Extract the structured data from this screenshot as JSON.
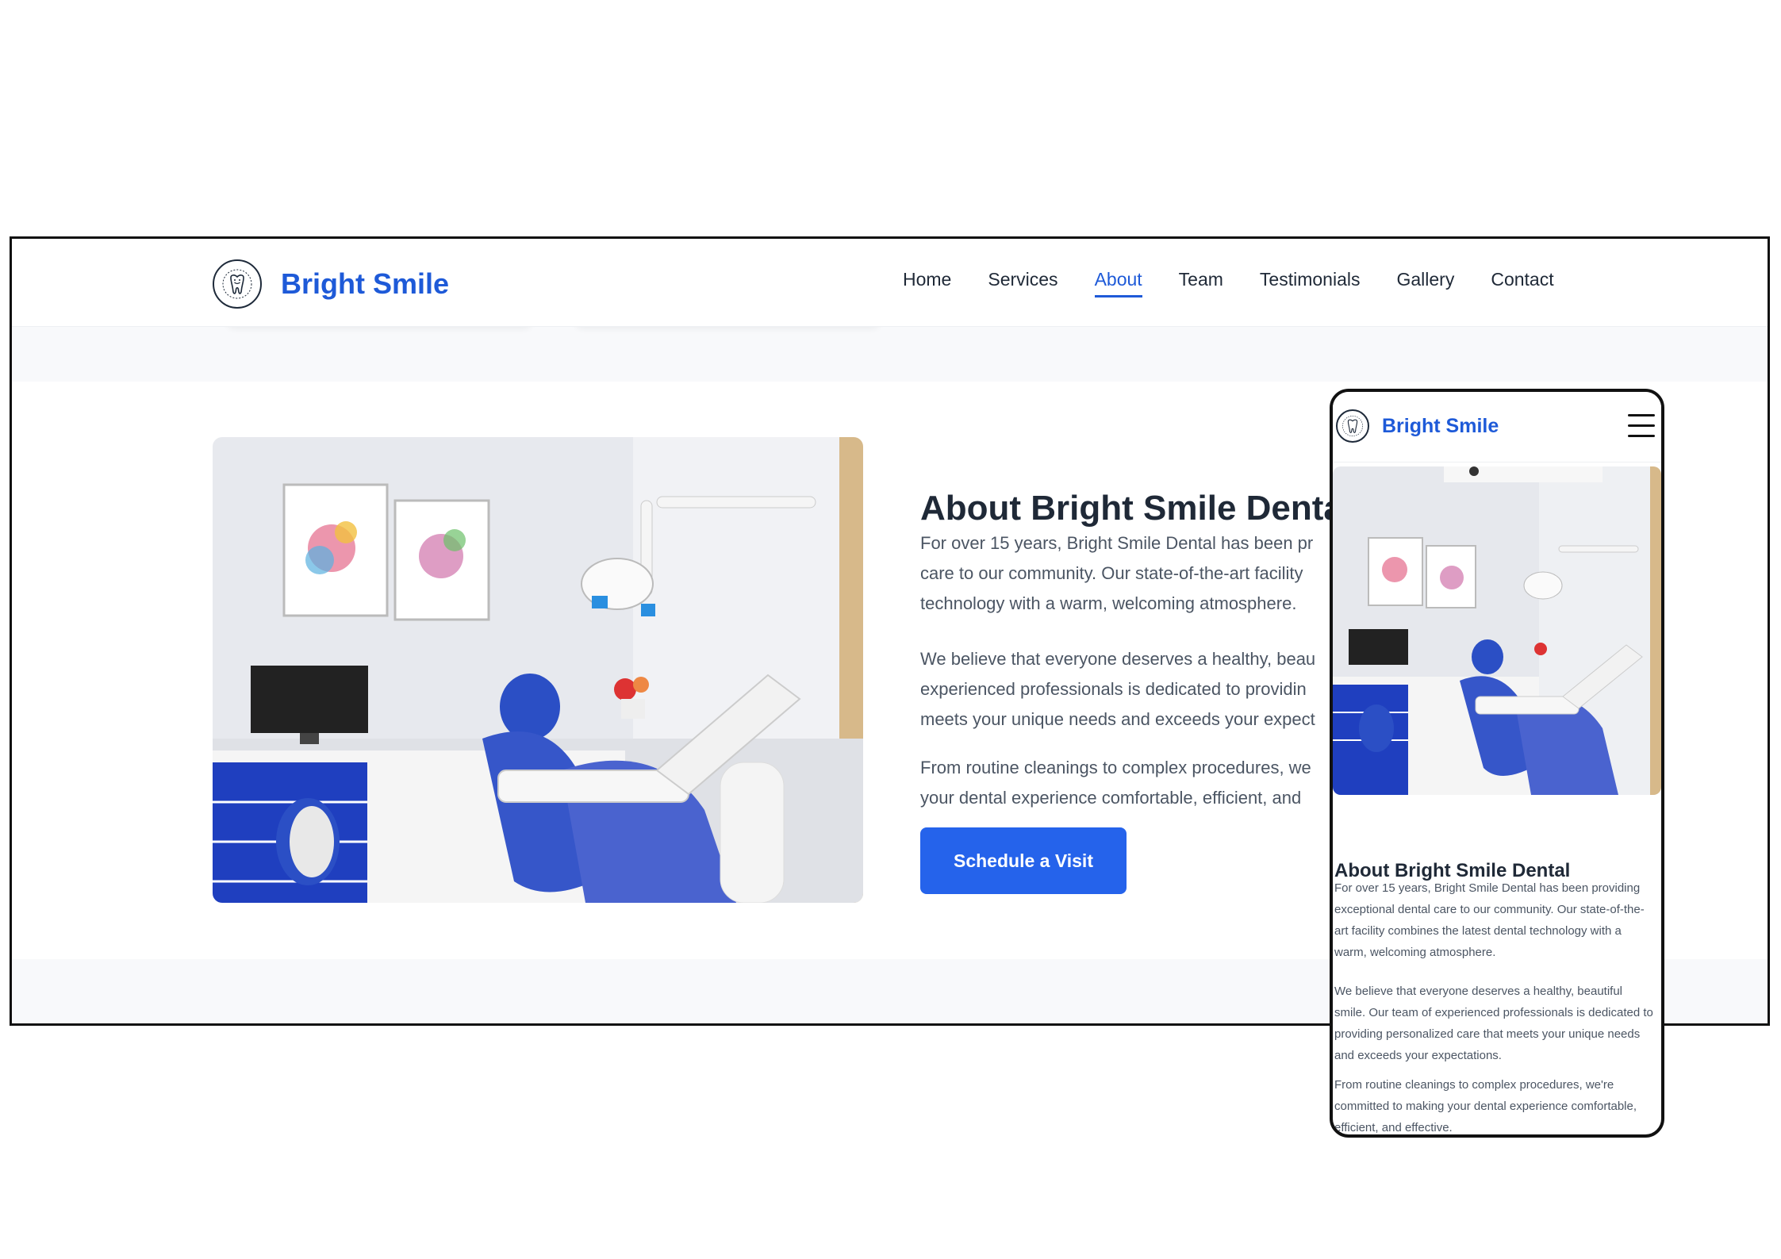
{
  "brand": {
    "name": "Bright Smile",
    "logo_icon": "tooth-icon"
  },
  "colors": {
    "accent": "#1e5ad8",
    "button": "#2563eb",
    "text": "#1f2937",
    "muted": "#4b5563",
    "section_bg": "#f8f9fb"
  },
  "nav": {
    "items": [
      {
        "label": "Home",
        "active": false
      },
      {
        "label": "Services",
        "active": false
      },
      {
        "label": "About",
        "active": true
      },
      {
        "label": "Team",
        "active": false
      },
      {
        "label": "Testimonials",
        "active": false
      },
      {
        "label": "Gallery",
        "active": false
      },
      {
        "label": "Contact",
        "active": false
      }
    ]
  },
  "about": {
    "image_alt": "dental-clinic-photo",
    "title": "About Bright Smile Dental",
    "desktop_lines": {
      "p1": [
        "For over 15 years, Bright Smile Dental has been pr",
        "care to our community. Our state-of-the-art facility",
        "technology with a warm, welcoming atmosphere."
      ],
      "p2": [
        "We believe that everyone deserves a healthy, beau",
        "experienced professionals is dedicated to providin",
        "meets your unique needs and exceeds your expect"
      ],
      "p3": [
        "From routine cleanings to complex procedures, we",
        "your dental experience comfortable, efficient, and"
      ]
    },
    "button_label": "Schedule a Visit",
    "paragraphs": [
      "For over 15 years, Bright Smile Dental has been providing exceptional dental care to our community. Our state-of-the-art facility combines the latest dental technology with a warm, welcoming atmosphere.",
      "We believe that everyone deserves a healthy, beautiful smile. Our team of experienced professionals is dedicated to providing personalized care that meets your unique needs and exceeds your expectations.",
      "From routine cleanings to complex procedures, we're committed to making your dental experience comfortable, efficient, and effective."
    ]
  },
  "mobile": {
    "menu_icon": "hamburger-menu-icon"
  }
}
